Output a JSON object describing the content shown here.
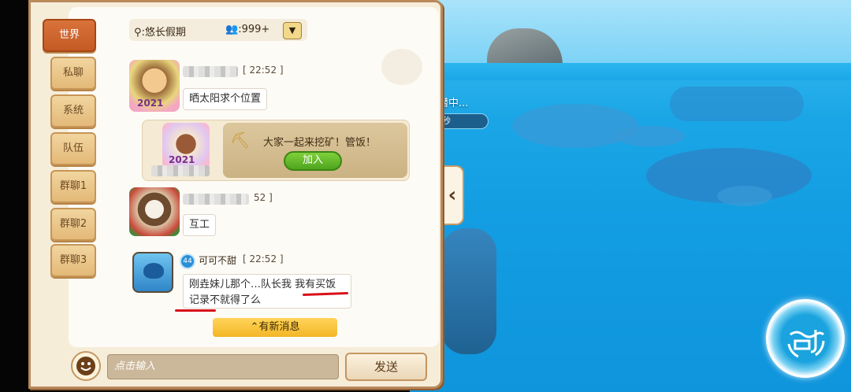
{
  "game_world": {
    "status_label": "潜中...",
    "status_pill": "秒"
  },
  "tabs": [
    {
      "label": "世界",
      "active": true
    },
    {
      "label": "私聊",
      "active": false
    },
    {
      "label": "系统",
      "active": false
    },
    {
      "label": "队伍",
      "active": false
    },
    {
      "label": "群聊1",
      "active": false
    },
    {
      "label": "群聊2",
      "active": false
    },
    {
      "label": "群聊3",
      "active": false
    }
  ],
  "header": {
    "location": "悠长假期",
    "online": ":999+"
  },
  "messages": [
    {
      "time": "[ 22:52 ]",
      "text": "晒太阳求个位置",
      "avatar_badge": "2021"
    },
    {
      "invite_text": "大家一起来挖矿！管饭！",
      "join_label": "加入",
      "avatar_badge": "2021"
    },
    {
      "time": "52 ]",
      "text": "互工"
    },
    {
      "level": "44",
      "name": "可可不甜",
      "time": "[ 22:52 ]",
      "text_line1": "刚垚妹儿那个…队长我 我有买饭",
      "text_line2": "记录不就得了么"
    }
  ],
  "new_messages_label": "有新消息",
  "input": {
    "placeholder": "点击输入"
  },
  "send_label": "发送",
  "colors": {
    "tab_active": "#c45a25",
    "join_green": "#4ea51e",
    "new_msg": "#f3b626",
    "underline": "#d8101a"
  }
}
